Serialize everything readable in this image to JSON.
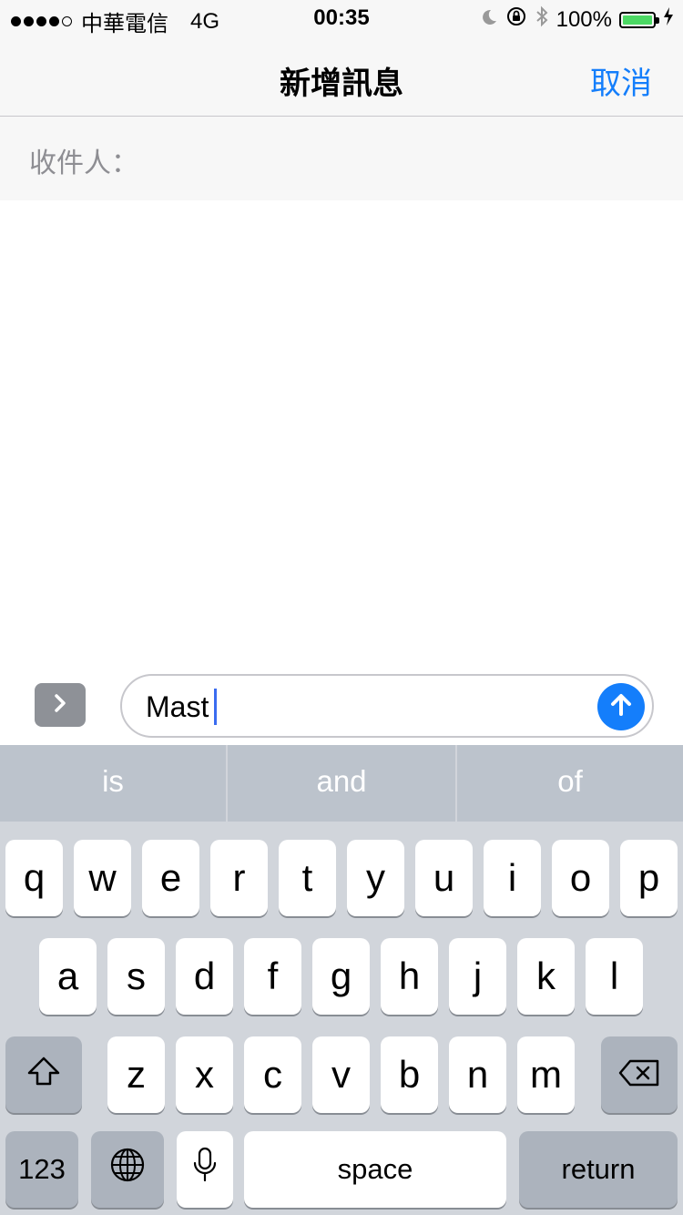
{
  "status_bar": {
    "carrier": "中華電信",
    "network": "4G",
    "time": "00:35",
    "battery": "100%",
    "signal_bars_filled": 4,
    "signal_bars_total": 5
  },
  "nav": {
    "title": "新增訊息",
    "cancel_label": "取消"
  },
  "recipients": {
    "label": "收件人："
  },
  "compose": {
    "message_text": "Mast"
  },
  "keyboard": {
    "suggestions": [
      "is",
      "and",
      "of"
    ],
    "row1": [
      "q",
      "w",
      "e",
      "r",
      "t",
      "y",
      "u",
      "i",
      "o",
      "p"
    ],
    "row2": [
      "a",
      "s",
      "d",
      "f",
      "g",
      "h",
      "j",
      "k",
      "l"
    ],
    "row3": [
      "z",
      "x",
      "c",
      "v",
      "b",
      "n",
      "m"
    ],
    "numbers_label": "123",
    "space_label": "space",
    "return_label": "return"
  },
  "colors": {
    "accent": "#147efb",
    "battery": "#4cd964",
    "keyboard_bg": "#d1d5db"
  },
  "icons": [
    "moon-icon",
    "rotation-lock-icon",
    "bluetooth-icon",
    "battery-icon",
    "charging-bolt-icon",
    "chevron-right-icon",
    "send-arrow-icon",
    "shift-icon",
    "backspace-icon",
    "globe-icon",
    "microphone-icon"
  ]
}
